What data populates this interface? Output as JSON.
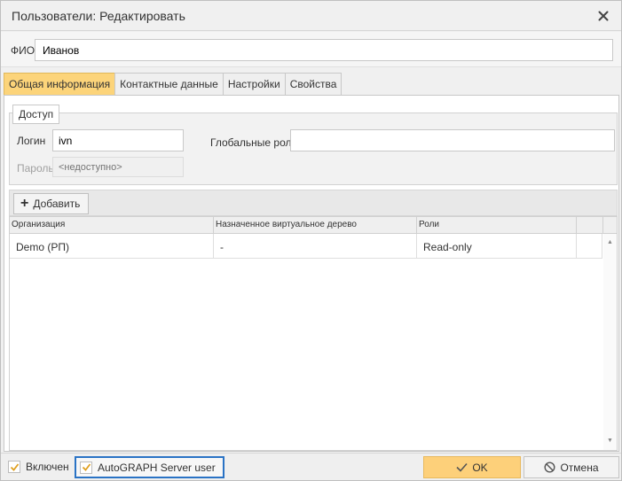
{
  "window": {
    "title": "Пользователи: Редактировать",
    "close_icon": "close-icon"
  },
  "fio": {
    "label": "ФИО",
    "value": "Иванов"
  },
  "tabs": [
    {
      "label": "Общая информация",
      "active": true
    },
    {
      "label": "Контактные данные",
      "active": false
    },
    {
      "label": "Настройки",
      "active": false
    },
    {
      "label": "Свойства",
      "active": false
    }
  ],
  "access": {
    "legend": "Доступ",
    "login_label": "Логин",
    "login_value": "ivn",
    "password_label": "Пароль",
    "password_placeholder": "<недоступно>",
    "global_roles_label": "Глобальные роли",
    "global_roles_value": ""
  },
  "toolbar": {
    "add_label": "Добавить"
  },
  "grid": {
    "columns": [
      "Организация",
      "Назначенное виртуальное дерево",
      "Роли"
    ],
    "rows": [
      {
        "organization": "Demo (РП)",
        "tree": "-",
        "roles": "Read-only"
      }
    ]
  },
  "footer": {
    "enabled_label": "Включен",
    "enabled_checked": true,
    "server_user_label": "AutoGRAPH Server user",
    "server_user_checked": true,
    "ok_label": "OK",
    "cancel_label": "Отмена"
  },
  "colors": {
    "accent": "#fcd47a",
    "focus": "#2a73c5",
    "check": "#e0a020"
  }
}
